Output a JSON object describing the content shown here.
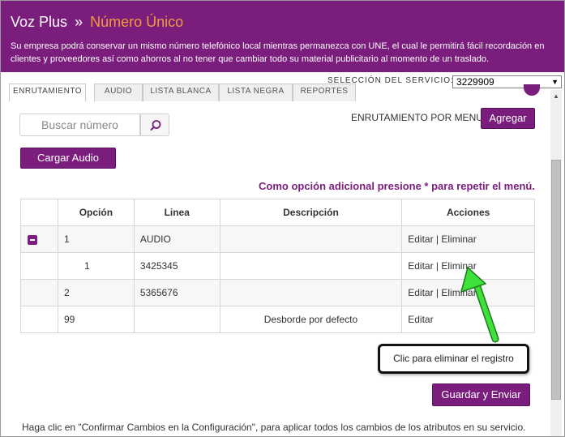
{
  "header": {
    "brand": "Voz Plus",
    "separator": "»",
    "page": "Número Único",
    "description": "Su empresa podrá conservar un mismo número telefónico local mientras permanezca con UNE, el cual le permitirá fácil recordación en clientes y proveedores así como ahorros al no tener que cambiar todo su material publicitario al momento de un traslado."
  },
  "service": {
    "label": "SELECCIÓN DEL SERVICIO:",
    "selected": "3229909"
  },
  "tabs": [
    {
      "label": "ENRUTAMIENTO",
      "active": true
    },
    {
      "label": "AUDIO",
      "active": false
    },
    {
      "label": "LISTA BLANCA",
      "active": false
    },
    {
      "label": "LISTA NEGRA",
      "active": false
    },
    {
      "label": "REPORTES",
      "active": false
    }
  ],
  "search": {
    "placeholder": "Buscar número"
  },
  "menu": {
    "label": "ENRUTAMIENTO POR MENU",
    "add_label": "Agregar"
  },
  "upload_label": "Cargar Audio",
  "note": "Como opción adicional presione * para repetir el menú.",
  "table": {
    "headers": [
      "",
      "Opción",
      "Linea",
      "Descripción",
      "Acciones"
    ],
    "rows": [
      {
        "option": "1",
        "line": "AUDIO",
        "description": "",
        "actions": "Editar | Eliminar"
      },
      {
        "option": "1",
        "line": "3425345",
        "description": "",
        "actions": "Editar | Eliminar"
      },
      {
        "option": "2",
        "line": "5365676",
        "description": "",
        "actions": "Editar | Eliminar"
      },
      {
        "option": "99",
        "line": "",
        "description": "Desborde por defecto",
        "actions": "Editar"
      }
    ]
  },
  "tooltip": "Clic para eliminar el registro",
  "save_label": "Guardar y Enviar",
  "footer": "Haga clic en \"Confirmar Cambios en la Configuración\", para aplicar todos los cambios de los atributos en su servicio.",
  "colors": {
    "brand": "#7a1d7d",
    "accent": "#f39a3a",
    "arrow": "#3ee03a"
  }
}
